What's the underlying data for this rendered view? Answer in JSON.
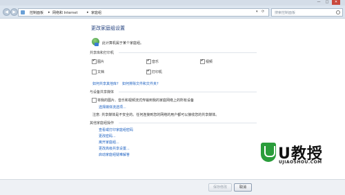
{
  "window": {
    "title": "",
    "minimize_label": "—",
    "maximize_label": "□",
    "close_label": "✕"
  },
  "address": {
    "breadcrumbs": [
      "控制面板",
      "网络和 Internet",
      "家庭组"
    ],
    "separator": "▸",
    "search_placeholder": "搜索控制面板"
  },
  "page": {
    "title": "更改家庭组设置",
    "member_text": "此计算机属于某个家庭组。",
    "share_section": {
      "heading": "共享库和打印机",
      "items": [
        {
          "label": "图片",
          "checked": true
        },
        {
          "label": "音乐",
          "checked": true
        },
        {
          "label": "视频",
          "checked": true
        },
        {
          "label": "文档",
          "checked": false
        },
        {
          "label": "打印机",
          "checked": true
        }
      ],
      "link1": "如何共享其他库?",
      "link2": "如何排除文件和文件夹?"
    },
    "media_section": {
      "heading": "与设备共享媒体",
      "stream_text": "将我的图片、音乐和视频流式传输到我的家庭网络上的所有设备",
      "stream_checked": false,
      "stream_link": "选择媒体流选项...",
      "note": "注意: 共享媒体是不安全的。任何连接到您的网络的用户都可以接收您的共享媒体。"
    },
    "other_section": {
      "heading": "其他家庭组操作",
      "links": [
        "查看或打印家庭组密码",
        "更改密码...",
        "离开家庭组...",
        "更改高级共享设置...",
        "启动家庭组疑难解答"
      ]
    }
  },
  "footer": {
    "save_label": "保存修改",
    "cancel_label": "取消"
  },
  "watermark": {
    "text": "U教授",
    "url": "UJIAOSHOU.COM"
  }
}
